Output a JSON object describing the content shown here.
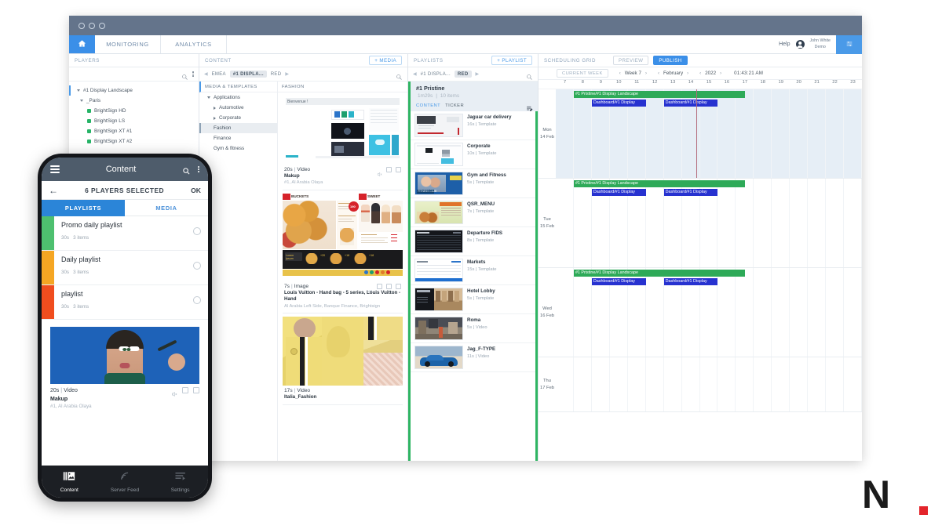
{
  "window": {
    "traffic_lights": 3
  },
  "topbar": {
    "home_icon": "home-icon",
    "tabs": [
      {
        "label": "MONITORING"
      },
      {
        "label": "ANALYTICS"
      }
    ],
    "help_label": "Help",
    "user_name": "John White",
    "user_org": "Demo",
    "grid_icon": "grid-toggle-icon"
  },
  "players": {
    "title": "PLAYERS",
    "search_icon": "search-icon",
    "menu_icon": "kebab-menu-icon",
    "tree": [
      {
        "label": "#1 Display Landscape",
        "level": 0,
        "type": "folder"
      },
      {
        "label": "_Paris",
        "level": 1,
        "type": "folder"
      },
      {
        "label": "BrightSign HD",
        "level": 2,
        "type": "player",
        "status": "#27b467"
      },
      {
        "label": "BrightSign LS",
        "level": 2,
        "type": "player",
        "status": "#27b467"
      },
      {
        "label": "BrightSign XT #1",
        "level": 2,
        "type": "player",
        "status": "#27b467"
      },
      {
        "label": "BrightSign XT #2",
        "level": 2,
        "type": "player",
        "status": "#27b467"
      }
    ]
  },
  "content": {
    "title": "CONTENT",
    "add_label": "+ MEDIA",
    "breadcrumbs": [
      {
        "label": "EMEA",
        "selected": false
      },
      {
        "label": "#1 DISPLA...",
        "selected": true
      },
      {
        "label": "RED",
        "selected": false
      }
    ],
    "media_templates_title": "MEDIA & TEMPLATES",
    "fashion_title": "FASHION",
    "tree": [
      {
        "label": "Applications",
        "level": 0,
        "arrow": "down"
      },
      {
        "label": "Automotive",
        "level": 1,
        "arrow": "right"
      },
      {
        "label": "Corporate",
        "level": 1,
        "arrow": "right"
      },
      {
        "label": "Fashion",
        "level": 1,
        "arrow": "none",
        "selected": true
      },
      {
        "label": "Finance",
        "level": 1,
        "arrow": "none"
      },
      {
        "label": "Gym & fitness",
        "level": 1,
        "arrow": "none"
      }
    ],
    "cards": [
      {
        "duration": "20s",
        "kind": "Video",
        "title": "Makup",
        "subtitle": "#1, Al Arabia Olaya",
        "art": "bienvenue-template",
        "art_label": "Bienvenue !"
      },
      {
        "duration": "7s",
        "kind": "Image",
        "title": "Louis Vuitton - Hand bag - 5 series, Louis Vuitton - Hand",
        "subtitle": "Al Arabia Left Side, Banque Finance, Brightsign",
        "art": "qsr-buckets-menu",
        "art_label_left": "BUCKETS",
        "art_label_right": "SWEET"
      },
      {
        "duration": "17s",
        "kind": "Video",
        "title": "Italia_Fashion",
        "subtitle": "",
        "art": "italia-fashion-triptych"
      }
    ]
  },
  "playlists": {
    "title": "PLAYLISTS",
    "add_label": "+ PLAYLIST",
    "breadcrumbs": [
      {
        "label": "#1 DISPLA...",
        "selected": false
      },
      {
        "label": "RED",
        "selected": true
      }
    ],
    "current": {
      "name": "#1 Pristine",
      "duration": "1m29s",
      "items_count": "10 items",
      "tab_content": "CONTENT",
      "tab_ticker": "TICKER",
      "edit_icon": "playlist-edit-icon",
      "accent": "#2fb563"
    },
    "items": [
      {
        "title": "Jaguar car delivery",
        "meta": "16s | Template",
        "art": "jaguar-car"
      },
      {
        "title": "Corporate",
        "meta": "10s | Template",
        "art": "corporate-slide"
      },
      {
        "title": "Gym and Fitness",
        "meta": "5s | Template",
        "art": "gym-fitness"
      },
      {
        "title": "QSR_MENU",
        "meta": "7s | Template",
        "art": "qsr-menu"
      },
      {
        "title": "Departure FIDS",
        "meta": "8s | Template",
        "art": "departure-fids"
      },
      {
        "title": "Markets",
        "meta": "15s | Template",
        "art": "markets-table"
      },
      {
        "title": "Hotel Lobby",
        "meta": "5s | Template",
        "art": "hotel-lobby"
      },
      {
        "title": "Roma",
        "meta": "5s | Video",
        "art": "roma-video"
      },
      {
        "title": "Jag_F-TYPE",
        "meta": "11s | Video",
        "art": "jaguar-ftype"
      }
    ]
  },
  "scheduling": {
    "title": "SCHEDULING GRID",
    "preview_label": "PREVIEW",
    "publish_label": "PUBLISH",
    "current_week_label": "CURRENT WEEK",
    "week_label": "Week 7",
    "month_label": "February",
    "year_label": "2022",
    "clock": "01:43:21 AM",
    "hours": [
      "7",
      "8",
      "9",
      "10",
      "11",
      "12",
      "13",
      "14",
      "15",
      "16",
      "17",
      "18",
      "19",
      "20",
      "21",
      "22",
      "23"
    ],
    "now_hour": 14.8,
    "days": [
      {
        "day": "Mon",
        "date": "14 Feb",
        "active": true,
        "events": [
          {
            "label": "#1 Pristine/#1 Display Landscape",
            "color": "green",
            "start": 8,
            "end": 17.5,
            "lane": 0
          },
          {
            "label": "Dashboard/#1 Display",
            "color": "blue",
            "start": 9,
            "end": 12,
            "lane": 1
          },
          {
            "label": "Dashboard/#1 Display",
            "color": "blue",
            "start": 13,
            "end": 16,
            "lane": 1
          }
        ]
      },
      {
        "day": "Tue",
        "date": "15 Feb",
        "active": false,
        "events": [
          {
            "label": "#1 Pristine/#1 Display Landscape",
            "color": "green",
            "start": 8,
            "end": 17.5,
            "lane": 0
          },
          {
            "label": "Dashboard/#1 Display",
            "color": "blue",
            "start": 9,
            "end": 12,
            "lane": 1
          },
          {
            "label": "Dashboard/#1 Display",
            "color": "blue",
            "start": 13,
            "end": 16,
            "lane": 1
          }
        ]
      },
      {
        "day": "Wed",
        "date": "16 Feb",
        "active": false,
        "events": [
          {
            "label": "#1 Pristine/#1 Display Landscape",
            "color": "green",
            "start": 8,
            "end": 17.5,
            "lane": 0
          },
          {
            "label": "Dashboard/#1 Display",
            "color": "blue",
            "start": 9,
            "end": 12,
            "lane": 1
          },
          {
            "label": "Dashboard/#1 Display",
            "color": "blue",
            "start": 13,
            "end": 16,
            "lane": 1
          }
        ]
      },
      {
        "day": "Thu",
        "date": "17 Feb",
        "active": false,
        "events": []
      }
    ]
  },
  "phone": {
    "appbar_title": "Content",
    "menu_icon": "hamburger-icon",
    "search_icon": "search-icon",
    "overflow_icon": "kebab-menu-icon",
    "back_icon": "back-arrow-icon",
    "selection_label": "6 PLAYERS SELECTED",
    "ok_label": "OK",
    "tabs": [
      {
        "label": "PLAYLISTS",
        "active": true
      },
      {
        "label": "MEDIA",
        "active": false
      }
    ],
    "playlists": [
      {
        "name": "Promo daily playlist",
        "duration": "30s",
        "items": "3 items",
        "color": "#4ec06f"
      },
      {
        "name": "Daily playlist",
        "duration": "30s",
        "items": "3 items",
        "color": "#f5a623"
      },
      {
        "name": "playlist",
        "duration": "30s",
        "items": "3 items",
        "color": "#f04d1e"
      }
    ],
    "media_card": {
      "duration": "20s",
      "kind": "Video",
      "title": "Makup",
      "subtitle": "#1, Al Arabia Olaya",
      "art": "makeup-model-photo"
    },
    "bottom_nav": [
      {
        "label": "Content",
        "icon": "content-icon",
        "active": true
      },
      {
        "label": "Server Feed",
        "icon": "rss-feed-icon",
        "active": false
      },
      {
        "label": "Settings",
        "icon": "settings-icon",
        "active": false
      }
    ]
  },
  "logo": {
    "letter": "N",
    "dot_color": "#e3242b"
  },
  "colors": {
    "accent_blue": "#3b8fe8",
    "event_green": "#2eaa58",
    "event_blue": "#2732d0",
    "titlebar": "#64748b"
  }
}
